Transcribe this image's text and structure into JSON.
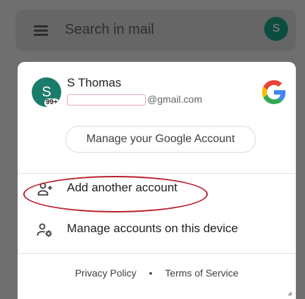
{
  "search_bar": {
    "placeholder": "Search in mail",
    "avatar_initial": "S"
  },
  "account": {
    "avatar_initial": "S",
    "unread_badge": "99+",
    "name": "S Thomas",
    "email_suffix": "@gmail.com",
    "manage_button_label": "Manage your Google Account"
  },
  "actions": [
    {
      "label": "Add another account",
      "icon": "add-person-icon"
    },
    {
      "label": "Manage accounts on this device",
      "icon": "manage-accounts-icon"
    }
  ],
  "footer": {
    "privacy_label": "Privacy Policy",
    "separator": "•",
    "terms_label": "Terms of Service"
  },
  "colors": {
    "avatar_green": "#1c7c6b",
    "highlight_red": "#b8202e",
    "google_blue": "#4285F4",
    "google_red": "#EA4335",
    "google_yellow": "#FBBC05",
    "google_green": "#34A853"
  }
}
